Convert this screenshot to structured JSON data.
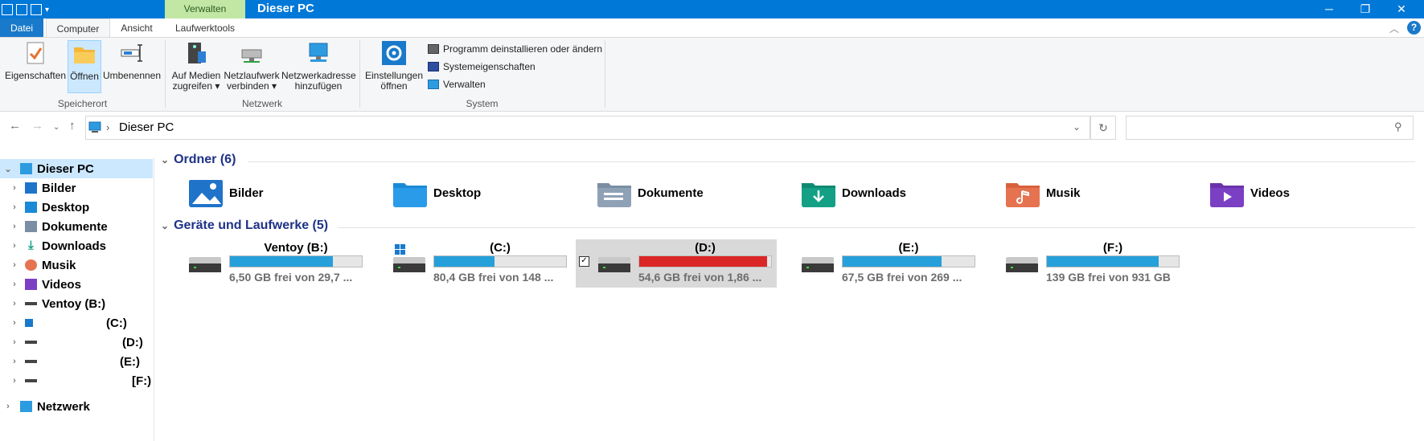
{
  "window": {
    "title": "Dieser PC",
    "context_tab": "Verwalten",
    "controls": {
      "minimize": "─",
      "maximize": "❐",
      "close": "✕"
    }
  },
  "ribbon_tabs": [
    "Datei",
    "Computer",
    "Ansicht",
    "Laufwerktools"
  ],
  "ribbon": {
    "speicherort": {
      "label": "Speicherort",
      "buttons": [
        "Eigenschaften",
        "Öffnen",
        "Umbenennen"
      ]
    },
    "netzwerk": {
      "label": "Netzwerk",
      "buttons": [
        {
          "line1": "Auf Medien",
          "line2": "zugreifen ▾"
        },
        {
          "line1": "Netzlaufwerk",
          "line2": "verbinden ▾"
        },
        {
          "line1": "Netzwerkadresse",
          "line2": "hinzufügen"
        }
      ]
    },
    "system": {
      "label": "System",
      "big_button": {
        "line1": "Einstellungen",
        "line2": "öffnen"
      },
      "small_buttons": [
        "Programm deinstallieren oder ändern",
        "Systemeigenschaften",
        "Verwalten"
      ]
    }
  },
  "address": {
    "path": "Dieser PC",
    "separator": "›",
    "search_placeholder": ""
  },
  "nav": [
    {
      "label": "Dieser PC",
      "selected": true,
      "level": 0
    },
    {
      "label": "Bilder",
      "level": 1
    },
    {
      "label": "Desktop",
      "level": 1
    },
    {
      "label": "Dokumente",
      "level": 1
    },
    {
      "label": "Downloads",
      "level": 1
    },
    {
      "label": "Musik",
      "level": 1
    },
    {
      "label": "Videos",
      "level": 1
    },
    {
      "label": "Ventoy (B:)",
      "level": 1
    },
    {
      "label": "(C:)",
      "level": 1
    },
    {
      "label": "(D:)",
      "level": 1
    },
    {
      "label": "(E:)",
      "level": 1
    },
    {
      "label": "[F:)",
      "level": 1
    },
    {
      "label": "Netzwerk",
      "level": 0
    }
  ],
  "sections": {
    "folders_title": "Ordner (6)",
    "drives_title": "Geräte und Laufwerke (5)"
  },
  "folders": [
    {
      "name": "Bilder",
      "color": "#1f74c9"
    },
    {
      "name": "Desktop",
      "color": "#1a8ad6"
    },
    {
      "name": "Dokumente",
      "color": "#7b8ea3"
    },
    {
      "name": "Downloads",
      "color": "#13a085"
    },
    {
      "name": "Musik",
      "color": "#e5734f"
    },
    {
      "name": "Videos",
      "color": "#7b3fc4"
    }
  ],
  "drives": [
    {
      "label": "Ventoy (B:)",
      "free": "6,50 GB frei von 29,7 ...",
      "used_fraction": 0.78,
      "color": "#26a0da"
    },
    {
      "label": "(C:)",
      "free": "80,4 GB frei von 148 ...",
      "used_fraction": 0.46,
      "color": "#26a0da"
    },
    {
      "label": "(D:)",
      "free": "54,6 GB frei von 1,86 ...",
      "used_fraction": 0.97,
      "color": "#da2626",
      "selected": true
    },
    {
      "label": "(E:)",
      "free": "67,5 GB frei von 269 ...",
      "used_fraction": 0.75,
      "color": "#26a0da"
    },
    {
      "label": "(F:)",
      "free": "139 GB frei von 931 GB",
      "used_fraction": 0.85,
      "color": "#26a0da"
    }
  ],
  "help": "?"
}
